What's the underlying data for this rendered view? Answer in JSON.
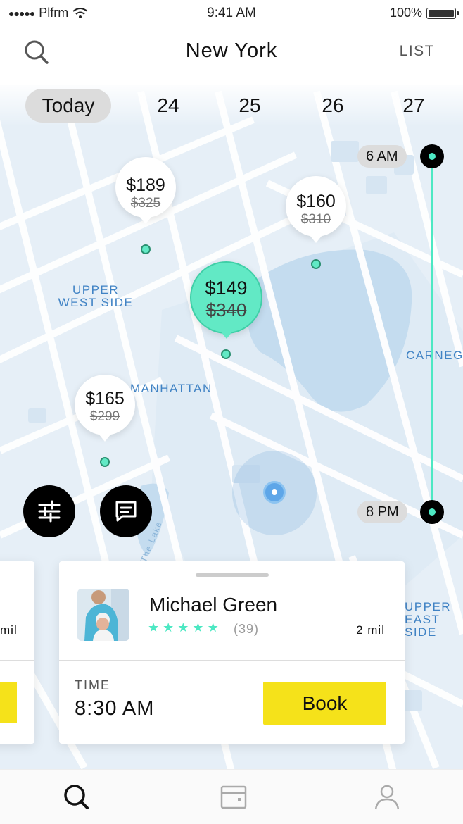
{
  "status_bar": {
    "carrier": "Plfrm",
    "time": "9:41 AM",
    "battery": "100%"
  },
  "header": {
    "title": "New York",
    "list_label": "LIST"
  },
  "dates": [
    "Today",
    "24",
    "25",
    "26",
    "27"
  ],
  "timeline": {
    "start": "6 AM",
    "end": "8 PM",
    "accent_color": "#4de8c3"
  },
  "pins": [
    {
      "price": "$189",
      "old_price": "$325"
    },
    {
      "price": "$160",
      "old_price": "$310"
    },
    {
      "price": "$149",
      "old_price": "$340"
    },
    {
      "price": "$165",
      "old_price": "$299"
    }
  ],
  "map_labels": {
    "upper_west_side": "UPPER WEST SIDE",
    "manhattan": "MANHATTAN",
    "carnegie": "CARNEGI",
    "upper_east_side": "UPPER EAST SIDE",
    "the_lake": "The Lake"
  },
  "cards": {
    "side": {
      "distance": "mil"
    },
    "main": {
      "name": "Michael Green",
      "rating": 5,
      "reviews": "(39)",
      "distance": "2 mil",
      "time_label": "TIME",
      "time": "8:30 AM",
      "book_label": "Book"
    }
  },
  "icons": [
    "search-icon",
    "filter-icon",
    "chat-icon",
    "search-tab-icon",
    "calendar-tab-icon",
    "profile-tab-icon"
  ],
  "colors": {
    "accent": "#4de8c3",
    "book_button": "#f5e21a",
    "map": "#e7f0f8",
    "water": "#c4dcef"
  }
}
